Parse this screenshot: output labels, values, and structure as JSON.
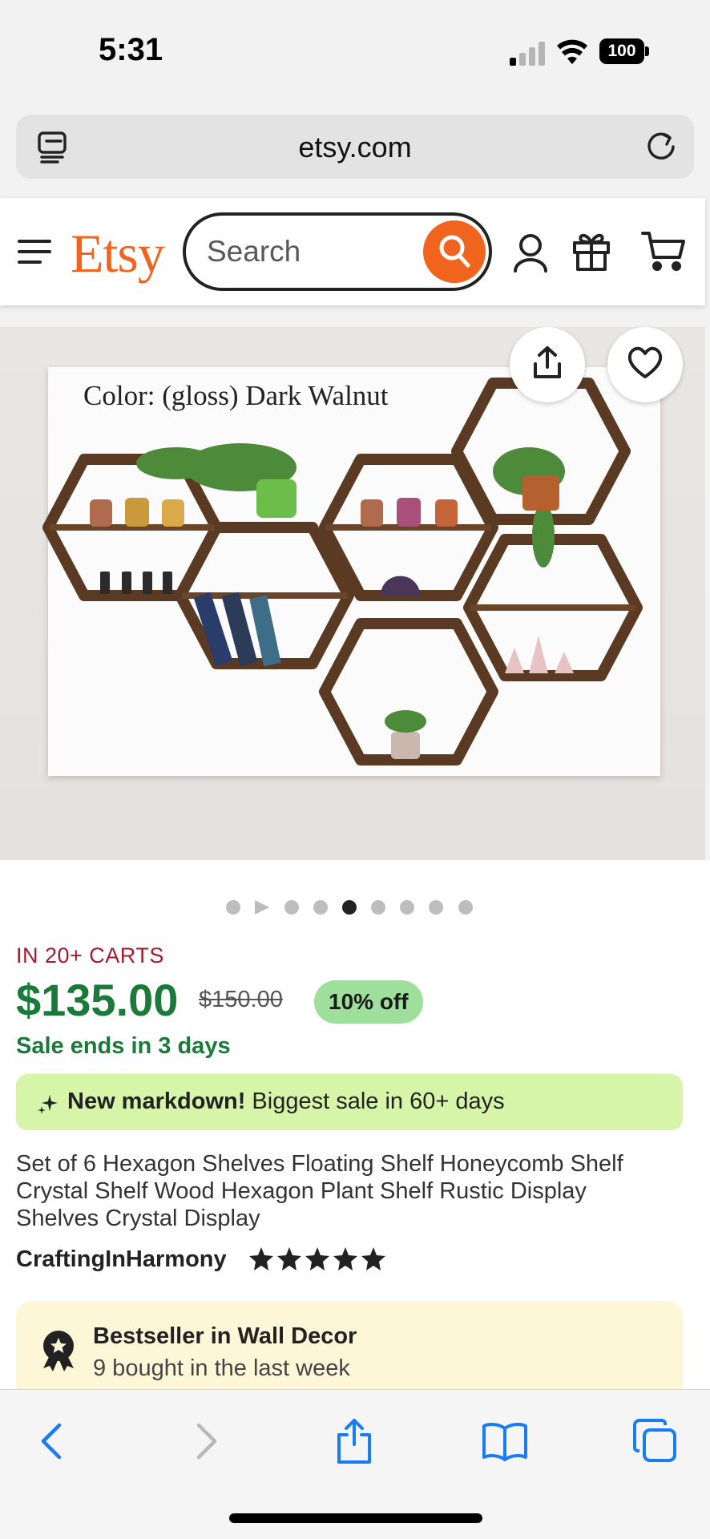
{
  "status_bar": {
    "time": "5:31",
    "battery": "100"
  },
  "browser": {
    "url": "etsy.com"
  },
  "header": {
    "logo": "Etsy",
    "search_placeholder": "Search"
  },
  "product": {
    "image_caption": "Color: (gloss) Dark Walnut",
    "image_dots": 9,
    "active_dot_index": 4,
    "in_carts": "IN 20+ CARTS",
    "price": "$135.00",
    "original_price": "$150.00",
    "discount": "10% off",
    "sale_ends": "Sale ends in 3 days",
    "markdown_bold": "New markdown!",
    "markdown_text": " Biggest sale in 60+ days",
    "title": "Set of 6 Hexagon Shelves Floating Shelf Honeycomb Shelf Crystal Shelf Wood Hexagon Plant Shelf Rustic Display Shelves Crystal Display",
    "shop_name": "CraftingInHarmony",
    "rating": 5,
    "bestseller_title": "Bestseller in Wall Decor",
    "bestseller_sub": "9 bought in the last week"
  },
  "colors": {
    "brand": "#f1641e",
    "price_green": "#1a7a3a",
    "carts_red": "#a61a2e",
    "badge_green": "#9ee09b",
    "markdown_bg": "#d7f5a9",
    "bestseller_bg": "#fdf7d8",
    "ios_blue": "#1a7cf5"
  },
  "icons": {
    "status": [
      "signal-icon",
      "wifi-icon",
      "battery-icon"
    ],
    "browser": [
      "tab-icon",
      "reload-icon"
    ],
    "header": [
      "menu-icon",
      "search-icon",
      "account-icon",
      "gift-icon",
      "cart-icon"
    ],
    "image": [
      "share-icon",
      "heart-icon"
    ],
    "toolbar": [
      "back-icon",
      "forward-icon",
      "share-icon",
      "bookmarks-icon",
      "tabs-icon"
    ]
  }
}
